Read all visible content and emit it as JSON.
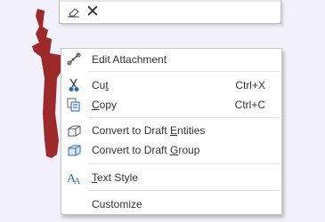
{
  "toolbar": {
    "icons": [
      "eraser-icon",
      "close-icon"
    ],
    "close_glyph": "✕"
  },
  "context_menu": {
    "items": [
      {
        "label": "Edit Attachment",
        "icon": "attachment-link-icon",
        "shortcut": ""
      },
      {
        "label": "Cut",
        "icon": "scissors-icon",
        "shortcut": "Ctrl+X",
        "access_key": "t"
      },
      {
        "label": "Copy",
        "icon": "copy-icon",
        "shortcut": "Ctrl+C",
        "access_key": "C"
      },
      {
        "label": "Convert to Draft Entities",
        "icon": "draft-entities-icon",
        "shortcut": "",
        "access_key": "E"
      },
      {
        "label": "Convert to Draft Group",
        "icon": "draft-group-icon",
        "shortcut": "",
        "access_key": "G"
      },
      {
        "label": "Text Style",
        "icon": "text-style-icon",
        "shortcut": "",
        "access_key": "T"
      },
      {
        "label": "Customize",
        "icon": "",
        "shortcut": ""
      }
    ]
  },
  "colors": {
    "background": "#f2f0fa",
    "drag_shape": "#9c2a2a",
    "menu_bg": "#ffffff",
    "separator": "#e0e0e0",
    "icon_blue": "#2b6cb0"
  }
}
